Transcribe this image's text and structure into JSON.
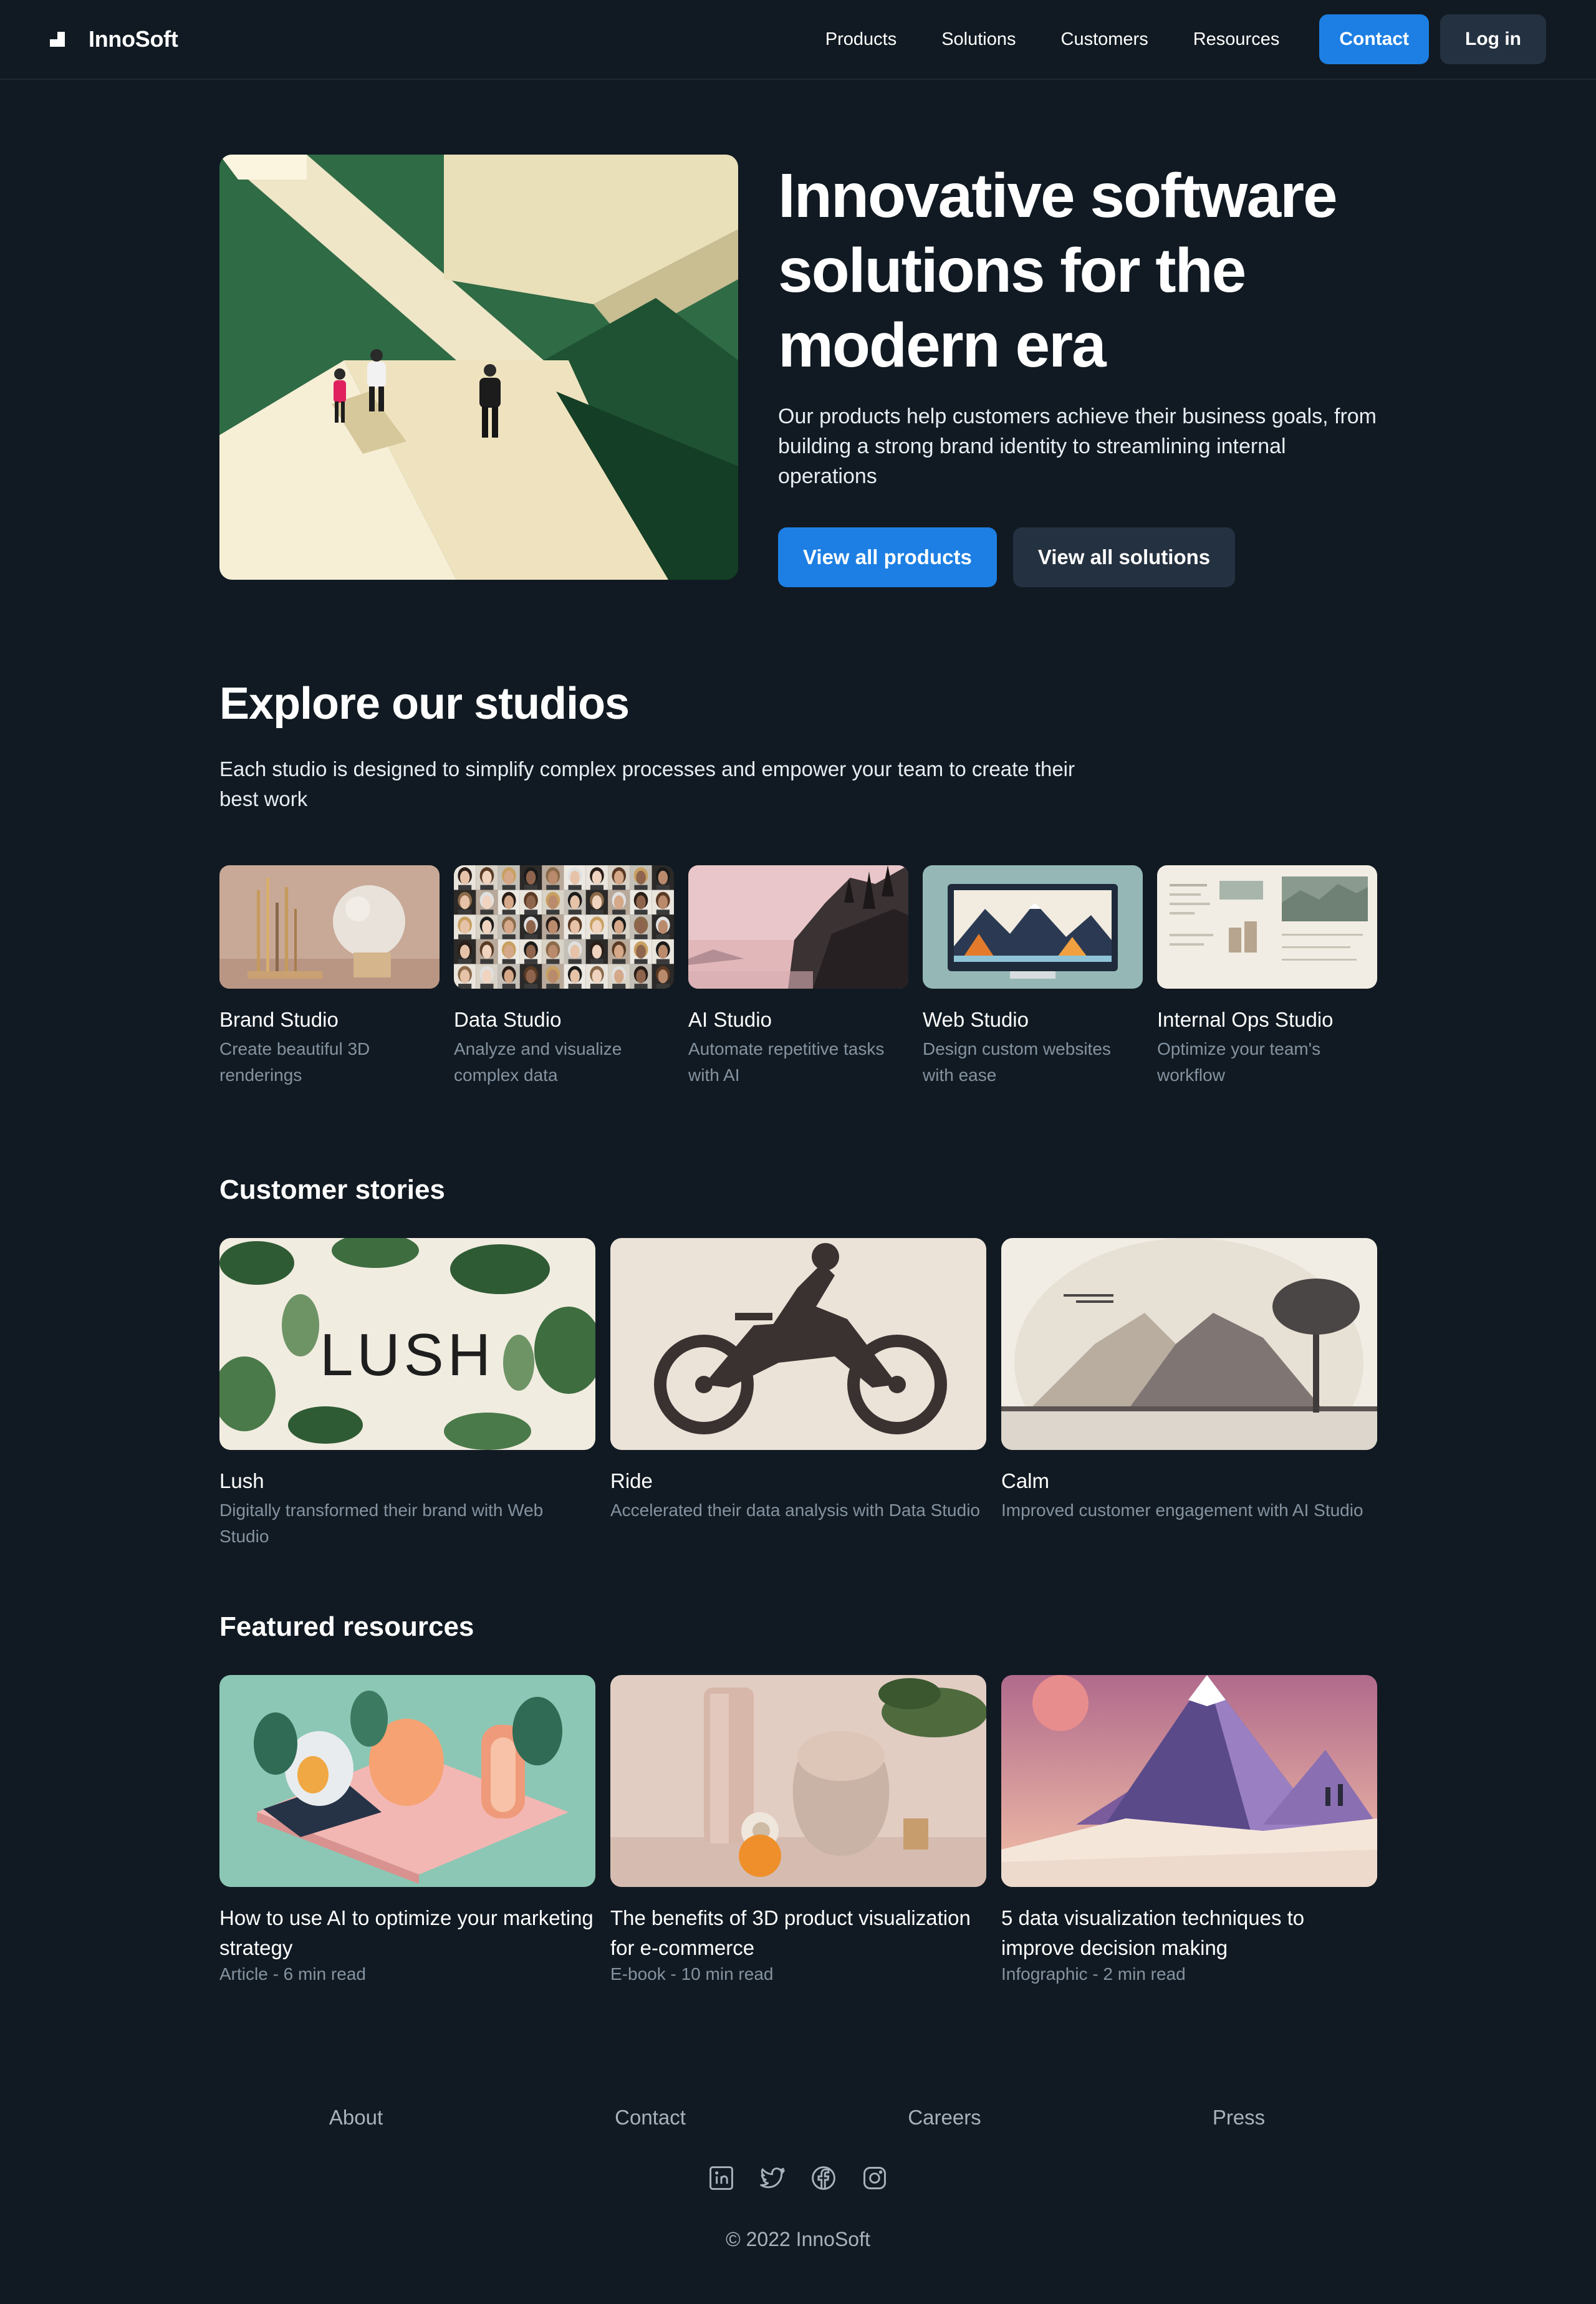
{
  "brand": {
    "name": "InnoSoft",
    "logo_icon": "bar-chart-logo-icon"
  },
  "nav": {
    "links": [
      "Products",
      "Solutions",
      "Customers",
      "Resources"
    ],
    "contact_label": "Contact",
    "login_label": "Log in"
  },
  "hero": {
    "title": "Innovative software solutions for the modern era",
    "subtitle": "Our products help customers achieve their business goals, from building a strong brand identity to streamlining internal operations",
    "primary_cta": "View all products",
    "secondary_cta": "View all solutions"
  },
  "studios": {
    "title": "Explore our studios",
    "subtitle": "Each studio is designed to simplify complex processes and empower your team to create their best work",
    "items": [
      {
        "title": "Brand Studio",
        "desc": "Create beautiful 3D renderings"
      },
      {
        "title": "Data Studio",
        "desc": "Analyze and visualize complex data"
      },
      {
        "title": "AI Studio",
        "desc": "Automate repetitive tasks with AI"
      },
      {
        "title": "Web Studio",
        "desc": "Design custom websites with ease"
      },
      {
        "title": "Internal Ops Studio",
        "desc": "Optimize your team's workflow"
      }
    ]
  },
  "stories": {
    "title": "Customer stories",
    "items": [
      {
        "name": "Lush",
        "desc": "Digitally transformed their brand with Web Studio",
        "logo_text": "LUSH"
      },
      {
        "name": "Ride",
        "desc": "Accelerated their data analysis with Data Studio"
      },
      {
        "name": "Calm",
        "desc": "Improved customer engagement with AI Studio"
      }
    ]
  },
  "resources": {
    "title": "Featured resources",
    "items": [
      {
        "title": "How to use AI to optimize your marketing strategy",
        "meta": "Article - 6 min read"
      },
      {
        "title": "The benefits of 3D product visualization for e-commerce",
        "meta": "E-book - 10 min read"
      },
      {
        "title": "5 data visualization techniques to improve decision making",
        "meta": "Infographic - 2 min read"
      }
    ]
  },
  "footer": {
    "links": [
      "About",
      "Contact",
      "Careers",
      "Press"
    ],
    "social_icons": [
      "linkedin-icon",
      "twitter-icon",
      "facebook-icon",
      "instagram-icon"
    ],
    "copyright": "© 2022 InnoSoft"
  },
  "colors": {
    "background": "#111a22",
    "accent": "#1d7fe3",
    "secondary_button": "#243140",
    "muted_text": "#8593a1"
  }
}
